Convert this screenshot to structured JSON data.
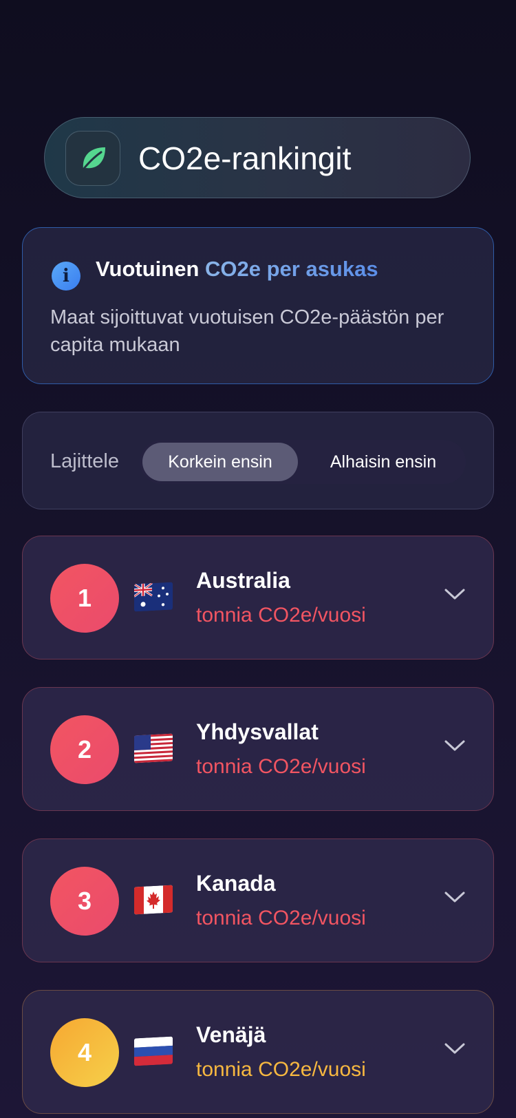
{
  "header": {
    "title": "CO2e-rankingit",
    "icon": "leaf-icon"
  },
  "info": {
    "icon": "info-icon",
    "title_plain": "Vuotuinen ",
    "title_accent": "CO2e per asukas",
    "description": "Maat sijoittuvat vuotuisen CO2e-päästön per capita mukaan"
  },
  "sort": {
    "label": "Lajittele",
    "options": [
      "Korkein ensin",
      "Alhaisin ensin"
    ],
    "selected": "Korkein ensin"
  },
  "rankings": [
    {
      "rank": "1",
      "country": "Australia",
      "unit": "tonnia CO2e/vuosi",
      "flag": "flag-australia-icon",
      "color": "#f25562"
    },
    {
      "rank": "2",
      "country": "Yhdysvallat",
      "unit": "tonnia CO2e/vuosi",
      "flag": "flag-usa-icon",
      "color": "#f25562"
    },
    {
      "rank": "3",
      "country": "Kanada",
      "unit": "tonnia CO2e/vuosi",
      "flag": "flag-canada-icon",
      "color": "#f25562"
    },
    {
      "rank": "4",
      "country": "Venäjä",
      "unit": "tonnia CO2e/vuosi",
      "flag": "flag-russia-icon",
      "color": "#f7b840"
    }
  ]
}
